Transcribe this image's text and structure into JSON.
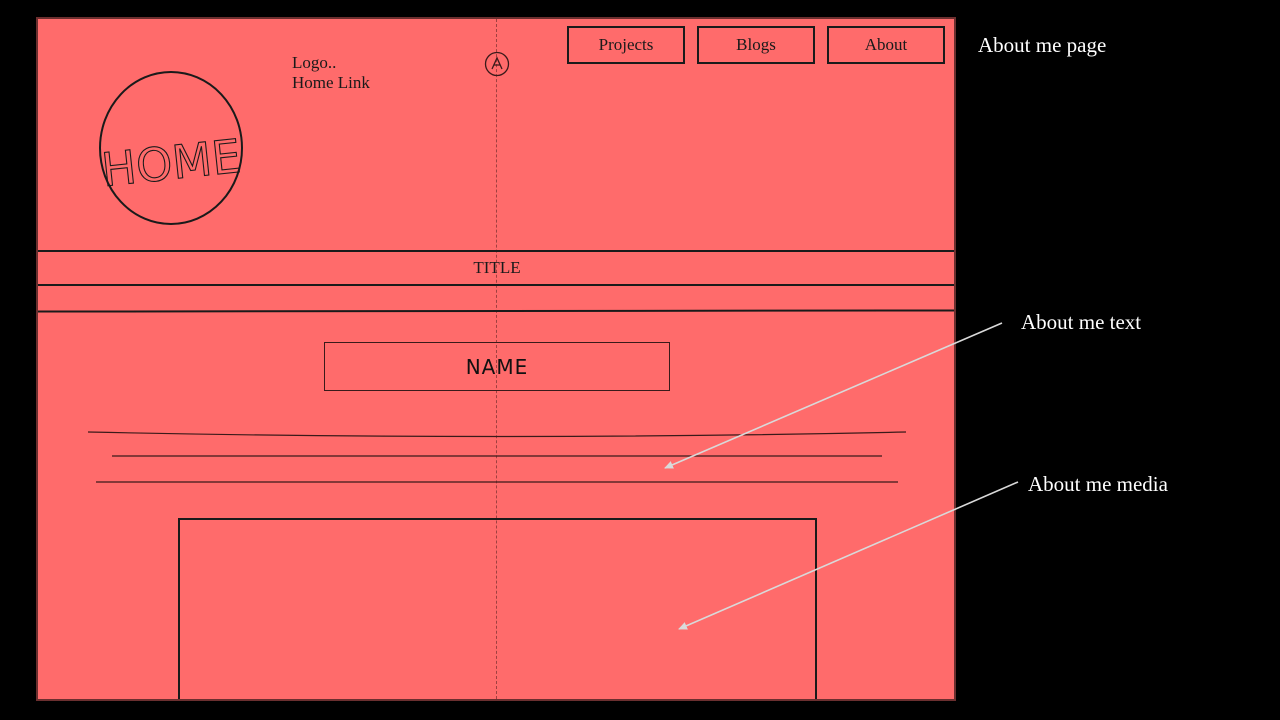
{
  "wireframe": {
    "logo_line": "Logo..",
    "home_link_line": "Home Link",
    "nav": {
      "projects_label": "Projects",
      "blogs_label": "Blogs",
      "about_label": "About"
    },
    "home_circle_label": "HOME",
    "title_label": "TITLE",
    "name_label": "NAME",
    "icons": {
      "brand": "circle-a-icon",
      "home": "home-circle-sketch"
    }
  },
  "annotations": {
    "page_label": "About me page",
    "text_label": "About me text",
    "media_label": "About me media"
  },
  "colors": {
    "page_background": "#000000",
    "wireframe_fill": "#ff6b6b",
    "ink": "#1a1a1a",
    "annotation_text": "#ffffff",
    "arrow": "#d9d9d9"
  }
}
